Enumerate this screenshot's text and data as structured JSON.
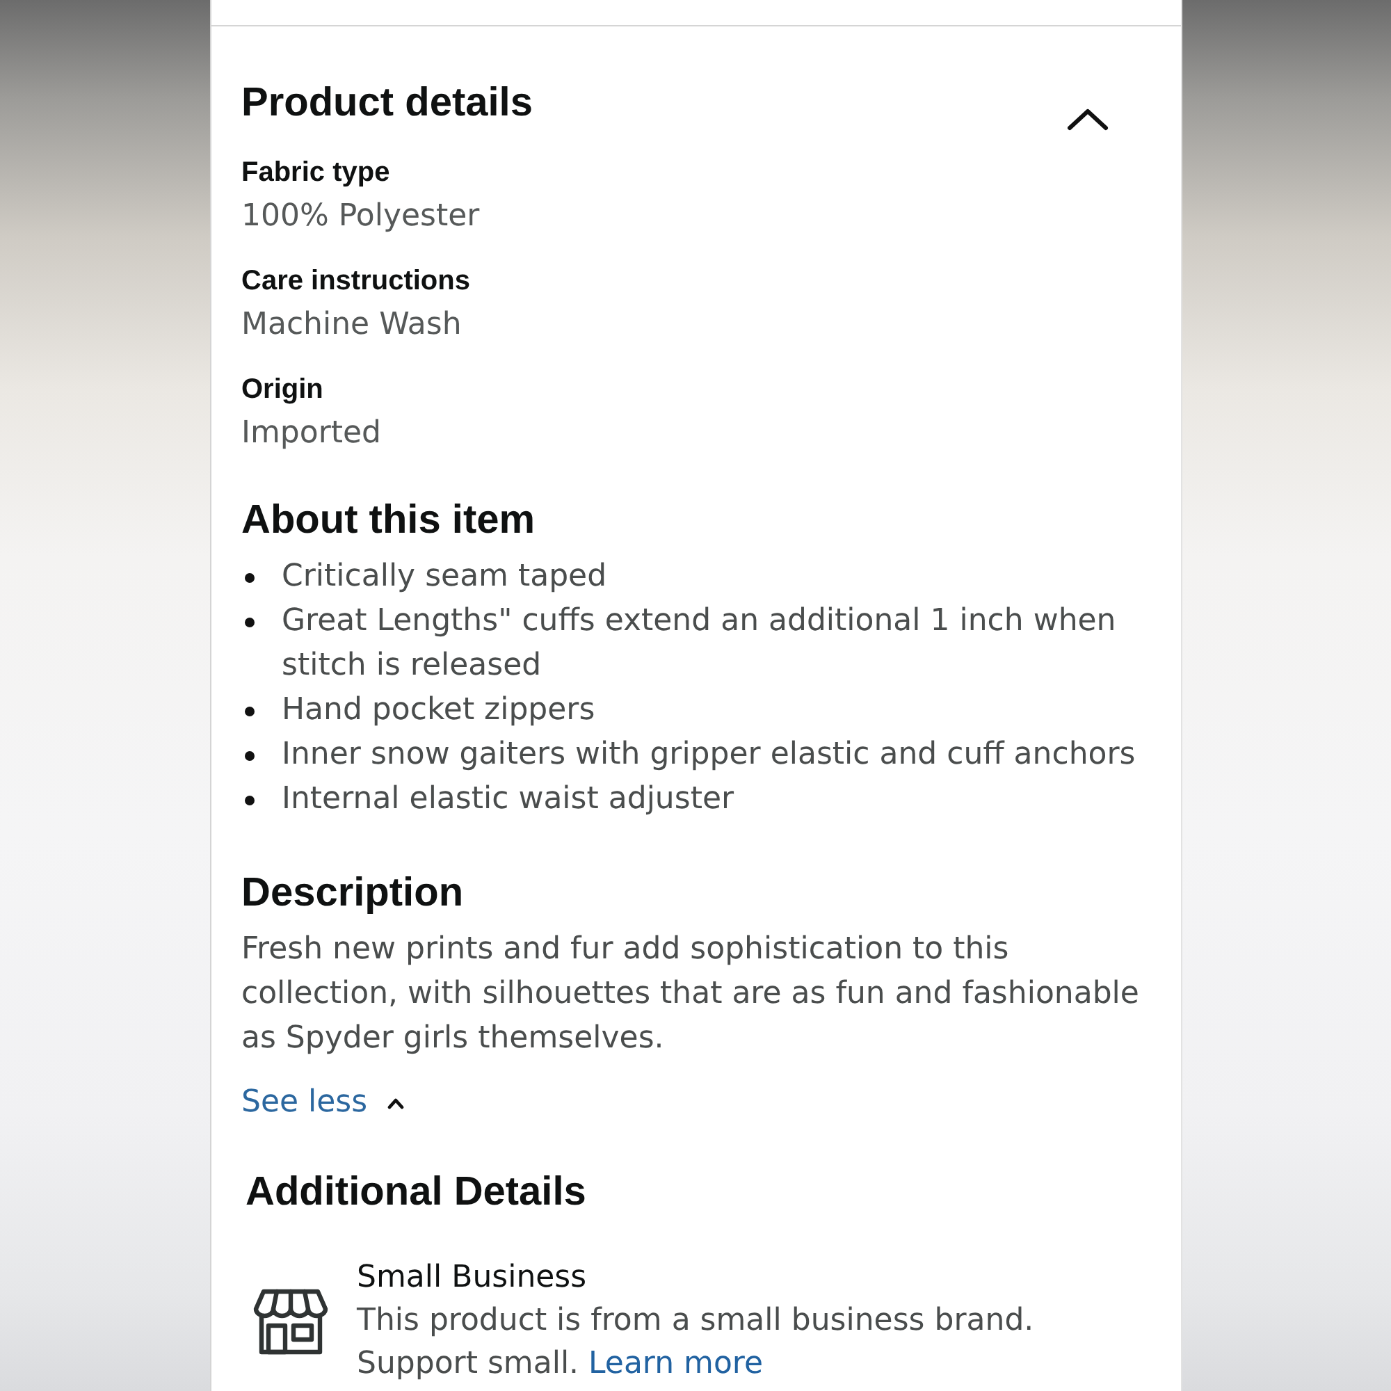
{
  "product_details": {
    "title": "Product details",
    "expanded": true,
    "attributes": [
      {
        "label": "Fabric type",
        "value": "100% Polyester"
      },
      {
        "label": "Care instructions",
        "value": "Machine Wash"
      },
      {
        "label": "Origin",
        "value": "Imported"
      }
    ]
  },
  "about_this_item": {
    "title": "About this item",
    "bullets": [
      "Critically seam taped",
      "Great Lengths\" cuffs extend an additional 1 inch when stitch is released",
      "Hand pocket zippers",
      "Inner snow gaiters with gripper elastic and cuff anchors",
      "Internal elastic waist adjuster"
    ]
  },
  "description": {
    "title": "Description",
    "text": "Fresh new prints and fur add sophistication to this collection, with silhouettes that are as fun and fashionable as Spyder girls themselves.",
    "toggle": {
      "label": "See less",
      "expanded": true
    }
  },
  "additional_details": {
    "title": "Additional Details",
    "badges": [
      {
        "title": "Small Business",
        "text": "This product is from a small business brand. Support small.",
        "link": "Learn more"
      }
    ]
  }
}
